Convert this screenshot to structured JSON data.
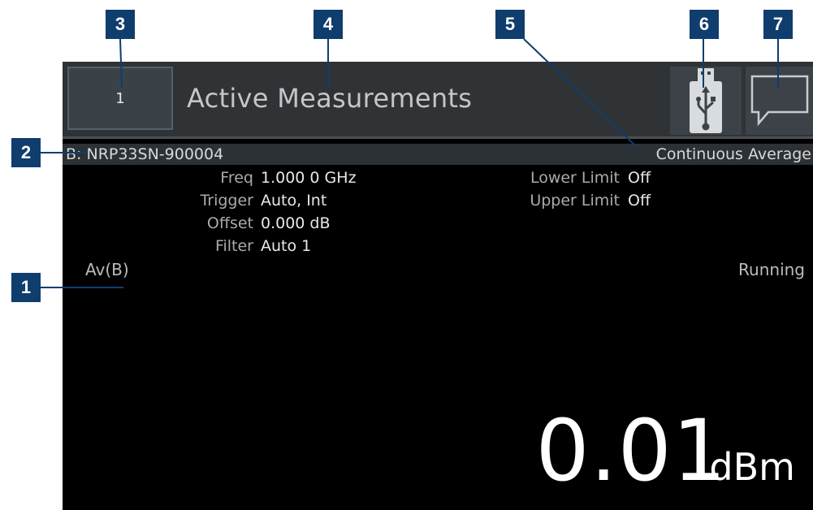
{
  "callouts": [
    "1",
    "2",
    "3",
    "4",
    "5",
    "6",
    "7"
  ],
  "titlebar": {
    "channel_button": "1",
    "title": "Active Measurements",
    "usb_icon": "usb-icon",
    "message_icon": "message-icon"
  },
  "sensor": {
    "id": "B: NRP33SN-900004",
    "mode": "Continuous Average"
  },
  "params_left": [
    {
      "label": "Freq",
      "value": "1.000 0 GHz"
    },
    {
      "label": "Trigger",
      "value": "Auto, Int"
    },
    {
      "label": "Offset",
      "value": "0.000 dB"
    },
    {
      "label": "Filter",
      "value": "Auto 1"
    }
  ],
  "params_right": [
    {
      "label": "Lower Limit",
      "value": "Off"
    },
    {
      "label": "Upper Limit",
      "value": "Off"
    }
  ],
  "measurement": {
    "function": "Av(B)",
    "status": "Running",
    "value": "0.01",
    "unit": "dBm"
  },
  "colors": {
    "callout": "#0f3d6e",
    "screen_bg": "#000000",
    "titlebar_bg": "#2f3336"
  }
}
